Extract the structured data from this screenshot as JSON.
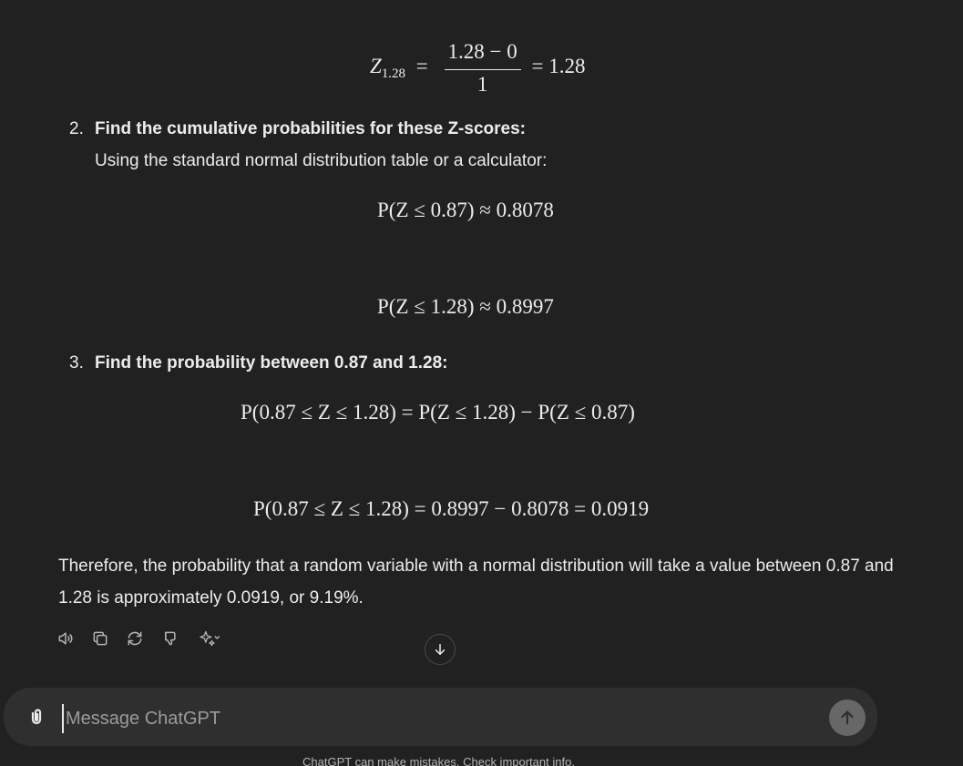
{
  "math": {
    "z128": {
      "lhs_var": "Z",
      "lhs_sub": "1.28",
      "eq": "=",
      "numerator": "1.28 − 0",
      "denominator": "1",
      "rhs": "= 1.28"
    },
    "p1": "P(Z ≤ 0.87) ≈ 0.8078",
    "p2": "P(Z ≤ 1.28) ≈ 0.8997",
    "p3": "P(0.87 ≤ Z ≤ 1.28) = P(Z ≤ 1.28) − P(Z ≤ 0.87)",
    "p4": "P(0.87 ≤ Z ≤ 1.28) = 0.8997 − 0.8078 = 0.0919"
  },
  "steps": [
    {
      "number": "2.",
      "title": "Find the cumulative probabilities for these Z-scores:",
      "subtext": "Using the standard normal distribution table or a calculator:"
    },
    {
      "number": "3.",
      "title": "Find the probability between 0.87 and 1.28:"
    }
  ],
  "conclusion": "Therefore, the probability that a random variable with a normal distribution will take a value between 0.87 and 1.28 is approximately 0.0919, or 9.19%.",
  "actions": {
    "icons": [
      "read-aloud-icon",
      "copy-icon",
      "regenerate-icon",
      "thumbs-down-icon",
      "sparkle-icon"
    ]
  },
  "composer": {
    "placeholder": "Message ChatGPT"
  },
  "footer_note": "ChatGPT can make mistakes. Check important info."
}
